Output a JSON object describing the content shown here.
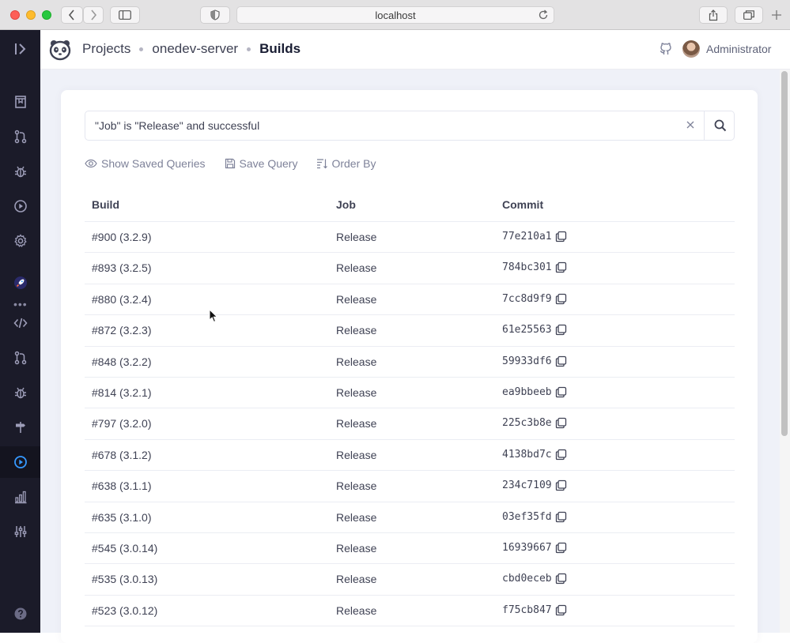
{
  "browser": {
    "url": "localhost"
  },
  "header": {
    "breadcrumb": [
      "Projects",
      "onedev-server",
      "Builds"
    ],
    "user": "Administrator"
  },
  "search": {
    "query": "\"Job\" is \"Release\" and successful"
  },
  "actions": {
    "saved_queries": "Show Saved Queries",
    "save_query": "Save Query",
    "order_by": "Order By"
  },
  "table": {
    "columns": [
      "Build",
      "Job",
      "Commit"
    ],
    "rows": [
      {
        "build": "#900 (3.2.9)",
        "job": "Release",
        "commit": "77e210a1"
      },
      {
        "build": "#893 (3.2.5)",
        "job": "Release",
        "commit": "784bc301"
      },
      {
        "build": "#880 (3.2.4)",
        "job": "Release",
        "commit": "7cc8d9f9"
      },
      {
        "build": "#872 (3.2.3)",
        "job": "Release",
        "commit": "61e25563"
      },
      {
        "build": "#848 (3.2.2)",
        "job": "Release",
        "commit": "59933df6"
      },
      {
        "build": "#814 (3.2.1)",
        "job": "Release",
        "commit": "ea9bbeeb"
      },
      {
        "build": "#797 (3.2.0)",
        "job": "Release",
        "commit": "225c3b8e"
      },
      {
        "build": "#678 (3.1.2)",
        "job": "Release",
        "commit": "4138bd7c"
      },
      {
        "build": "#638 (3.1.1)",
        "job": "Release",
        "commit": "234c7109"
      },
      {
        "build": "#635 (3.1.0)",
        "job": "Release",
        "commit": "03ef35fd"
      },
      {
        "build": "#545 (3.0.14)",
        "job": "Release",
        "commit": "16939667"
      },
      {
        "build": "#535 (3.0.13)",
        "job": "Release",
        "commit": "cbd0eceb"
      },
      {
        "build": "#523 (3.0.12)",
        "job": "Release",
        "commit": "f75cb847"
      }
    ]
  },
  "colors": {
    "rail_bg": "#1b1b29",
    "accent": "#3699ff",
    "page_bg": "#eff1f8"
  }
}
